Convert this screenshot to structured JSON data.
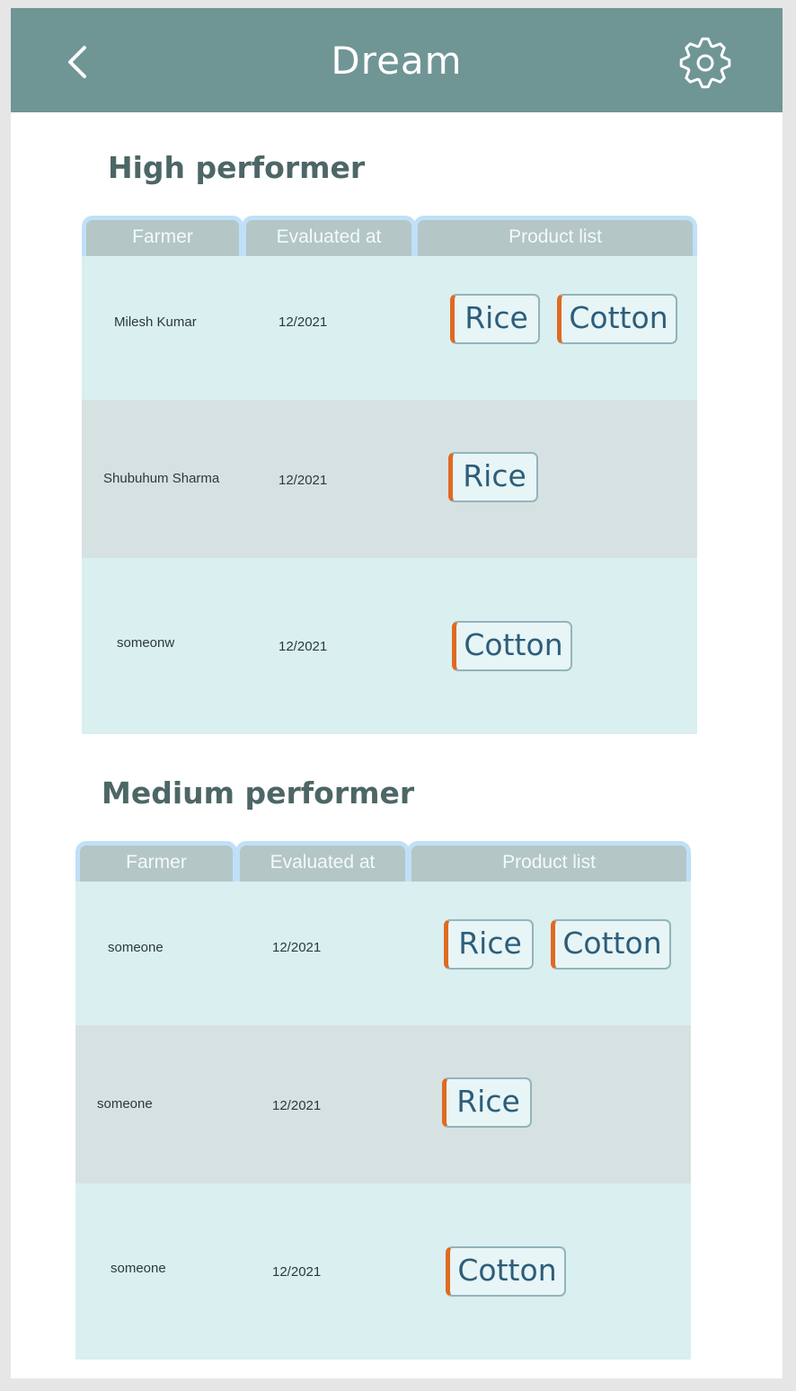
{
  "app": {
    "title": "Dream"
  },
  "icons": {
    "back": "chevron-left-icon",
    "settings": "gear-icon"
  },
  "colors": {
    "appbar": "#709595",
    "accent": "#e06a22",
    "row_light": "#daeff0",
    "row_alt": "#d6e2e2"
  },
  "sections": [
    {
      "title": "High performer",
      "columns": [
        "Farmer",
        "Evaluated at",
        "Product list"
      ],
      "rows": [
        {
          "farmer": "Milesh Kumar",
          "date": "12/2021",
          "products": [
            "Rice",
            "Cotton"
          ]
        },
        {
          "farmer": "Shubuhum  Sharma",
          "date": "12/2021",
          "products": [
            "Rice"
          ]
        },
        {
          "farmer": "someonw",
          "date": "12/2021",
          "products": [
            "Cotton"
          ]
        }
      ]
    },
    {
      "title": "Medium performer",
      "columns": [
        "Farmer",
        "Evaluated at",
        "Product list"
      ],
      "rows": [
        {
          "farmer": "someone",
          "date": "12/2021",
          "products": [
            "Rice",
            "Cotton"
          ]
        },
        {
          "farmer": "someone",
          "date": "12/2021",
          "products": [
            "Rice"
          ]
        },
        {
          "farmer": "someone",
          "date": "12/2021",
          "products": [
            "Cotton"
          ]
        }
      ]
    }
  ]
}
